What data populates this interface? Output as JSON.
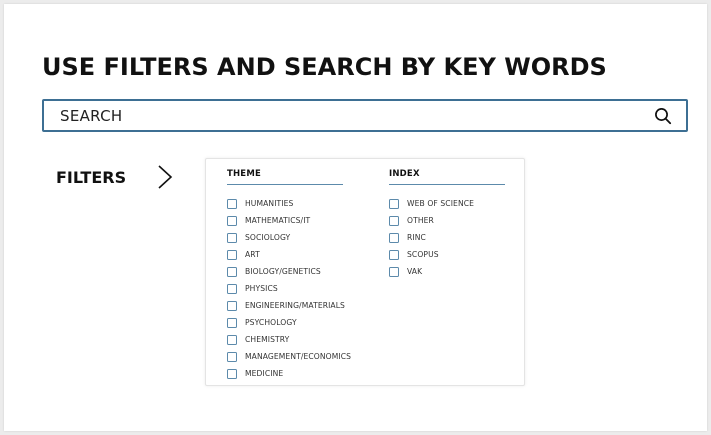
{
  "page": {
    "title": "USE FILTERS AND SEARCH BY KEY WORDS"
  },
  "search": {
    "placeholder": "SEARCH",
    "icon": "search-icon"
  },
  "filters": {
    "label": "FILTERS",
    "toggle_icon": "chevron-right-icon",
    "columns": [
      {
        "heading": "THEME",
        "options": [
          {
            "label": "HUMANITIES",
            "checked": false
          },
          {
            "label": "MATHEMATICS/IT",
            "checked": false
          },
          {
            "label": "SOCIOLOGY",
            "checked": false
          },
          {
            "label": "ART",
            "checked": false
          },
          {
            "label": "BIOLOGY/GENETICS",
            "checked": false
          },
          {
            "label": "PHYSICS",
            "checked": false
          },
          {
            "label": "ENGINEERING/MATERIALS",
            "checked": false
          },
          {
            "label": "PSYCHOLOGY",
            "checked": false
          },
          {
            "label": "CHEMISTRY",
            "checked": false
          },
          {
            "label": "MANAGEMENT/ECONOMICS",
            "checked": false
          },
          {
            "label": "MEDICINE",
            "checked": false
          }
        ]
      },
      {
        "heading": "INDEX",
        "options": [
          {
            "label": "WEB OF SCIENCE",
            "checked": false
          },
          {
            "label": "OTHER",
            "checked": false
          },
          {
            "label": "RINC",
            "checked": false
          },
          {
            "label": "SCOPUS",
            "checked": false
          },
          {
            "label": "VAK",
            "checked": false
          }
        ]
      }
    ]
  },
  "colors": {
    "accent": "#3d6f93",
    "checkbox": "#5c8aab",
    "text": "#111111",
    "background": "#ececec",
    "card": "#ffffff"
  }
}
